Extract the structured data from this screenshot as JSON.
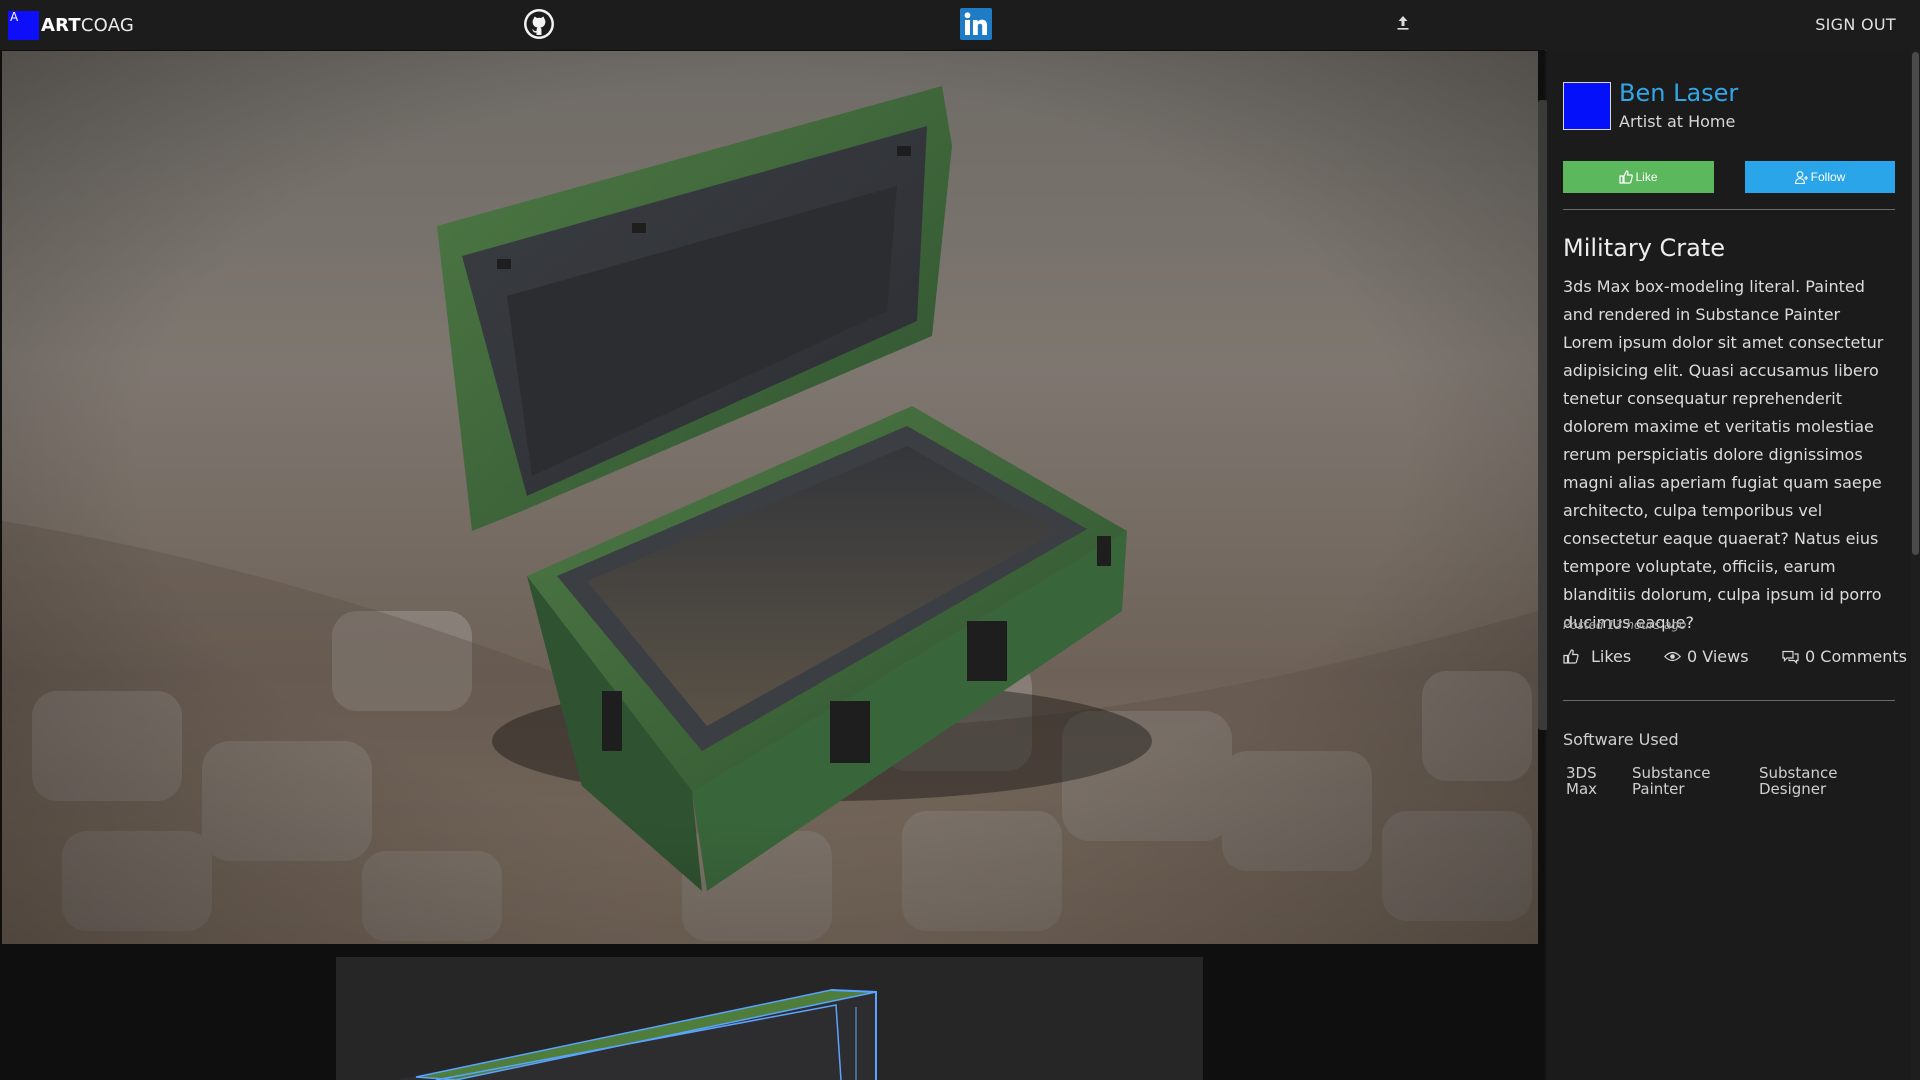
{
  "nav": {
    "logo_letter": "A",
    "logo_bold": "ART",
    "logo_light": "COAG",
    "github_icon": "github-icon",
    "linkedin_icon": "linkedin-icon",
    "upload_icon": "upload-icon",
    "signout_label": "SIGN OUT"
  },
  "author": {
    "name": "Ben Laser",
    "role": "Artist at Home"
  },
  "actions": {
    "like_label": "Like",
    "follow_label": "Follow"
  },
  "artwork": {
    "title": "Military Crate",
    "description": "3ds Max box-modeling literal. Painted and rendered in Substance Painter Lorem ipsum dolor sit amet consectetur adipisicing elit. Quasi accusamus libero tenetur consequatur reprehenderit dolorem maxime et veritatis molestiae rerum perspiciatis dolore dignissimos magni alias aperiam fugiat quam saepe architecto, culpa temporibus vel consectetur eaque quaerat? Natus eius tempore voluptate, officiis, earum blanditiis dolorum, culpa ipsum id porro ducimus eaque?",
    "posted": "Posted 13 hours ago"
  },
  "stats": {
    "likes": "Likes",
    "views": "0 Views",
    "comments": "0 Comments"
  },
  "software": {
    "label": "Software Used",
    "items": [
      {
        "line1": "3DS",
        "line2": "Max"
      },
      {
        "line1": "Substance",
        "line2": "Painter"
      },
      {
        "line1": "Substance",
        "line2": "Designer"
      }
    ]
  },
  "colors": {
    "like_button": "#5cb85c",
    "follow_button": "#2aa5e9",
    "author_name": "#33a6e8",
    "logo_box": "#0d0ffb"
  }
}
